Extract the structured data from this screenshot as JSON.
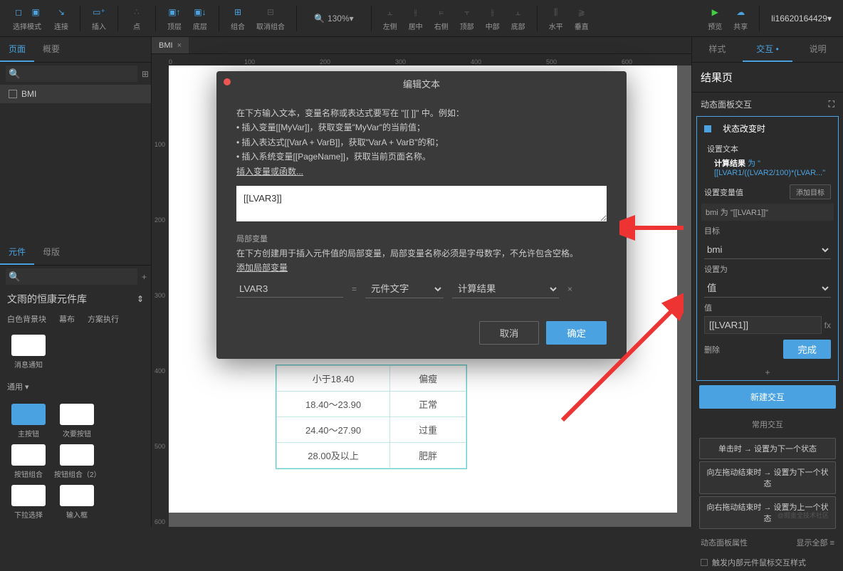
{
  "toolbar": {
    "select_mode": "选择模式",
    "connect": "连接",
    "insert": "插入",
    "point": "点",
    "top_layer": "顶层",
    "bottom_layer": "底层",
    "group": "组合",
    "ungroup": "取消组合",
    "zoom_value": "130%",
    "align_left": "左侧",
    "align_center": "居中",
    "align_right": "右侧",
    "align_top": "顶部",
    "align_middle": "中部",
    "align_bottom": "底部",
    "dist_h": "水平",
    "dist_v": "垂直",
    "preview": "预览",
    "share": "共享",
    "user": "li16620164429"
  },
  "left": {
    "tab_page": "页面",
    "tab_outline": "概要",
    "page_name": "BMI",
    "tab_widget": "元件",
    "tab_master": "母版",
    "lib_name": "文雨的恒康元件库",
    "filter1": "白色背景块",
    "filter2": "幕布",
    "filter3": "方案执行",
    "item_notice": "消息通知",
    "section_common": "通用",
    "items": [
      "主按钮",
      "次要按钮",
      "按钮组合",
      "按钮组合（2）",
      "下拉选择",
      "输入框"
    ]
  },
  "doc": {
    "tab": "BMI"
  },
  "table": {
    "rows": [
      [
        "小于18.40",
        "偏瘦"
      ],
      [
        "18.40～23.90",
        "正常"
      ],
      [
        "24.40～27.90",
        "过重"
      ],
      [
        "28.00及以上",
        "肥胖"
      ]
    ]
  },
  "right": {
    "tab_style": "样式",
    "tab_interact": "交互",
    "tab_desc": "说明",
    "panel_title": "结果页",
    "dyn_panel": "动态面板交互",
    "event": "状态改变时",
    "action1": "设置文本",
    "action1_desc_a": "计算结果",
    "action1_desc_b": "为 \"[[LVAR1/((LVAR2/100)*(LVAR...\"",
    "action2": "设置变量值",
    "add_target": "添加目标",
    "var_line": "bmi 为 \"[[LVAR1]]\"",
    "target_label": "目标",
    "target_value": "bmi",
    "setas_label": "设置为",
    "setas_value": "值",
    "value_label": "值",
    "value_input": "[[LVAR1]]",
    "delete": "删除",
    "done": "完成",
    "new_interaction": "新建交互",
    "common_title": "常用交互",
    "common1": "单击时 → 设置为下一个状态",
    "common2": "向左拖动结束时 → 设置为下一个状态",
    "common3": "向右拖动结束时 → 设置为上一个状态",
    "dyn_attr": "动态面板属性",
    "show_all": "显示全部",
    "trigger_inner": "触发内部元件鼠标交互样式"
  },
  "modal": {
    "title": "编辑文本",
    "intro": "在下方输入文本，变量名称或表达式要写在 \"[[ ]]\" 中。例如：",
    "line1": "• 插入变量[[MyVar]]，获取变量\"MyVar\"的当前值；",
    "line2": "• 插入表达式[[VarA + VarB]]，获取\"VarA + VarB\"的和；",
    "line3": "• 插入系统变量[[PageName]]，获取当前页面名称。",
    "insert_link": "插入变量或函数...",
    "expr": "[[LVAR3]]",
    "local_var_header": "局部变量",
    "local_var_desc": "在下方创建用于插入元件值的局部变量，局部变量名称必须是字母数字，不允许包含空格。",
    "add_local": "添加局部变量",
    "lv_name": "LVAR3",
    "lv_type": "元件文字",
    "lv_target": "计算结果",
    "cancel": "取消",
    "ok": "确定"
  },
  "watermark": "@掘金全技术社区"
}
